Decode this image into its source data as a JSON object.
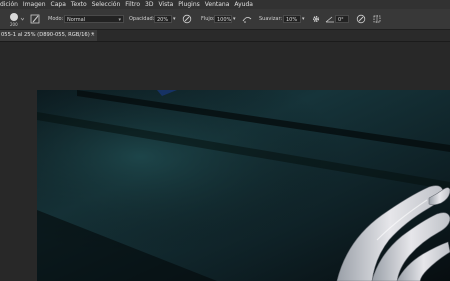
{
  "menu": {
    "items": [
      "dición",
      "Imagen",
      "Capa",
      "Texto",
      "Selección",
      "Filtro",
      "3D",
      "Vista",
      "Plugins",
      "Ventana",
      "Ayuda"
    ]
  },
  "options": {
    "brush_size": "200",
    "mode_label": "Modo:",
    "mode_value": "Normal",
    "opacity_label": "Opacidad:",
    "opacity_value": "20%",
    "flow_label": "Flujo:",
    "flow_value": "100%",
    "smooth_label": "Suavizar:",
    "smooth_value": "10%",
    "angle_value": "0°"
  },
  "document": {
    "tab_title": "055-1 al 25% (D890-055, RGB/16) *",
    "close_symbol": "×"
  },
  "colors": {
    "menubar": "#323232",
    "optionsbar": "#383838",
    "workspace": "#282828",
    "canvas_teal": "#16343a"
  }
}
